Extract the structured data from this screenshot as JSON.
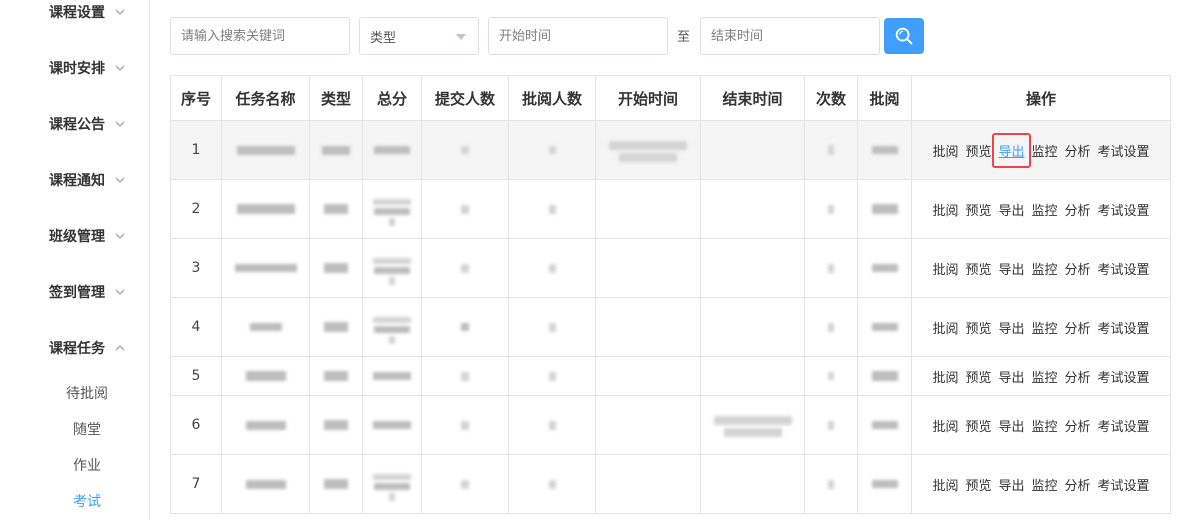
{
  "sidebar": {
    "menus": [
      {
        "label": "课程设置",
        "expanded": false
      },
      {
        "label": "课时安排",
        "expanded": false
      },
      {
        "label": "课程公告",
        "expanded": false
      },
      {
        "label": "课程通知",
        "expanded": false
      },
      {
        "label": "班级管理",
        "expanded": false
      },
      {
        "label": "签到管理",
        "expanded": false
      },
      {
        "label": "课程任务",
        "expanded": true
      }
    ],
    "sub_items": [
      {
        "label": "待批阅",
        "active": false
      },
      {
        "label": "随堂",
        "active": false
      },
      {
        "label": "作业",
        "active": false
      },
      {
        "label": "考试",
        "active": true
      }
    ]
  },
  "search": {
    "keyword_placeholder": "请输入搜索关键词",
    "type_placeholder": "类型",
    "start_placeholder": "开始时间",
    "range_separator": "至",
    "end_placeholder": "结束时间",
    "search_icon": "search-icon"
  },
  "table": {
    "headers": [
      "序号",
      "任务名称",
      "类型",
      "总分",
      "提交人数",
      "批阅人数",
      "开始时间",
      "结束时间",
      "次数",
      "批阅",
      "操作"
    ],
    "rows": [
      {
        "index": "1"
      },
      {
        "index": "2"
      },
      {
        "index": "3"
      },
      {
        "index": "4"
      },
      {
        "index": "5"
      },
      {
        "index": "6"
      },
      {
        "index": "7"
      }
    ],
    "actions": [
      "批阅",
      "预览",
      "导出",
      "监控",
      "分析",
      "考试设置"
    ],
    "focused_action": {
      "row": 0,
      "action": 2
    }
  },
  "colors": {
    "accent": "#409eff",
    "highlight_box": "#f0434b",
    "row_hover": "#f5f5f5"
  }
}
